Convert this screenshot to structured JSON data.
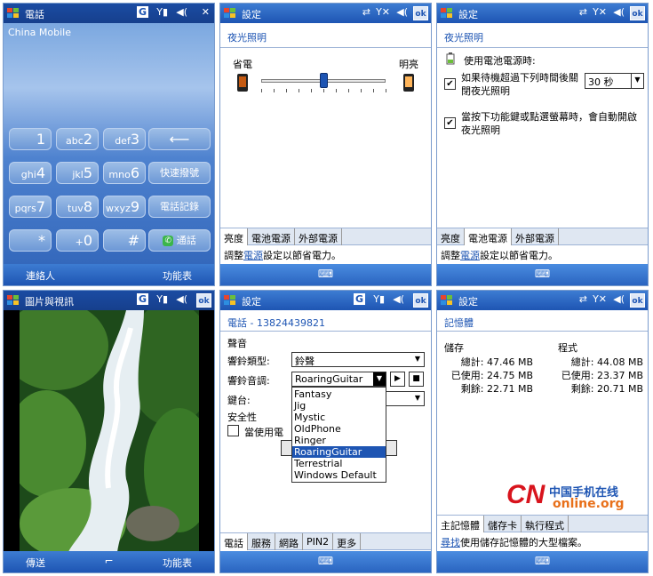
{
  "phone": {
    "title": "電話",
    "carrier": "China Mobile",
    "status_g": "G",
    "left_soft": "連絡人",
    "right_soft": "功能表",
    "keys": [
      {
        "n": "1",
        "l": ""
      },
      {
        "n": "2",
        "l": "abc"
      },
      {
        "n": "3",
        "l": "def"
      },
      {
        "n": "4",
        "l": "ghi"
      },
      {
        "n": "5",
        "l": "jkl"
      },
      {
        "n": "6",
        "l": "mno"
      },
      {
        "n": "7",
        "l": "pqrs"
      },
      {
        "n": "8",
        "l": "tuv"
      },
      {
        "n": "9",
        "l": "wxyz"
      },
      {
        "n": "*",
        "l": ""
      },
      {
        "n": "0",
        "l": "+"
      },
      {
        "n": "#",
        "l": ""
      }
    ],
    "speed_dial": "快速撥號",
    "call_log": "電話記錄",
    "call": "通話",
    "backspace": "⟵"
  },
  "backlight1": {
    "title": "設定",
    "subtitle": "夜光照明",
    "dim": "省電",
    "bright": "明亮",
    "level": 0.5,
    "tabs": [
      "亮度",
      "電池電源",
      "外部電源"
    ],
    "hint_pre": "調整",
    "hint_link": "電源",
    "hint_post": "設定以節省電力。"
  },
  "backlight2": {
    "title": "設定",
    "subtitle": "夜光照明",
    "battery_label": "使用電池電源時:",
    "opt1": "如果待機超過下列時間後關閉夜光照明",
    "opt1_value": "30 秒",
    "opt2": "當按下功能鍵或點選螢幕時，會自動開啟夜光照明",
    "tabs": [
      "亮度",
      "電池電源",
      "外部電源"
    ],
    "hint_pre": "調整",
    "hint_link": "電源",
    "hint_post": "設定以節省電力。"
  },
  "pictures": {
    "title": "圖片與視訊",
    "status_g": "G",
    "left_soft": "傳送",
    "right_soft": "功能表"
  },
  "ringtone": {
    "title": "設定",
    "status_g": "G",
    "subtitle": "電話 - 13824439821",
    "sound": "聲音",
    "ring_type_label": "響鈴類型:",
    "ring_type": "鈴聲",
    "ring_tone_label": "響鈴音調:",
    "ring_tone": "RoaringGuitar",
    "keypad_label": "鍵台:",
    "security": "安全性",
    "use_phone": "當使用電",
    "options": [
      "Fantasy",
      "Jig",
      "Mystic",
      "OldPhone",
      "Ringer",
      "RoaringGuitar",
      "Terrestrial",
      "Windows Default"
    ],
    "selected": "RoaringGuitar",
    "tabs": [
      "電話",
      "服務",
      "網路",
      "PIN2",
      "更多"
    ]
  },
  "memory": {
    "title": "設定",
    "subtitle": "記憶體",
    "storage": "儲存",
    "program": "程式",
    "total_l": "總計:",
    "used_l": "已使用:",
    "free_l": "剩餘:",
    "s_total": "47.46 MB",
    "s_used": "24.75 MB",
    "s_free": "22.71 MB",
    "p_total": "44.08 MB",
    "p_used": "23.37 MB",
    "p_free": "20.71 MB",
    "watermark_cn": "CN",
    "watermark_zh": "中国手机在线",
    "watermark_url": "online.org",
    "tabs": [
      "主記憶體",
      "儲存卡",
      "執行程式"
    ],
    "hint_link": "尋找",
    "hint_post": "使用儲存記憶體的大型檔案。"
  },
  "colors": {
    "accent": "#1e55b3",
    "titlebar": "#2a64c0"
  }
}
